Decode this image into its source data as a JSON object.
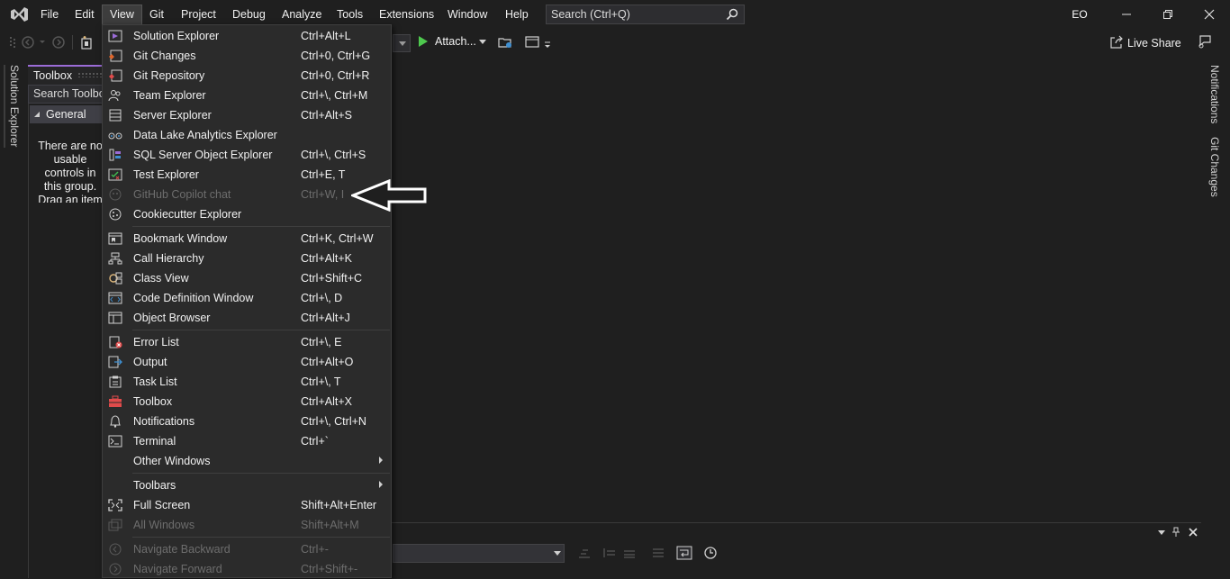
{
  "menubar": {
    "items": [
      "File",
      "Edit",
      "View",
      "Git",
      "Project",
      "Debug",
      "Analyze",
      "Tools",
      "Extensions",
      "Window",
      "Help"
    ],
    "active": "View"
  },
  "search": {
    "placeholder": "Search (Ctrl+Q)"
  },
  "profile": {
    "initials": "EO"
  },
  "toolbar": {
    "attach_label": "Attach...",
    "live_share_label": "Live Share"
  },
  "left_rail": {
    "solution_explorer": "Solution Explorer"
  },
  "right_rail": {
    "notifications": "Notifications",
    "git_changes": "Git Changes"
  },
  "toolbox": {
    "title": "Toolbox",
    "search_placeholder": "Search Toolbox",
    "group": "General",
    "empty_message": "There are no usable controls in this group. Drag an item onto this text to add it to the toolbox."
  },
  "view_menu": {
    "groups": [
      [
        {
          "label": "Solution Explorer",
          "shortcut": "Ctrl+Alt+L",
          "icon": "solution-explorer-icon",
          "enabled": true
        },
        {
          "label": "Git Changes",
          "shortcut": "Ctrl+0, Ctrl+G",
          "icon": "git-changes-icon",
          "enabled": true
        },
        {
          "label": "Git Repository",
          "shortcut": "Ctrl+0, Ctrl+R",
          "icon": "git-repository-icon",
          "enabled": true
        },
        {
          "label": "Team Explorer",
          "shortcut": "Ctrl+\\, Ctrl+M",
          "icon": "team-explorer-icon",
          "enabled": true
        },
        {
          "label": "Server Explorer",
          "shortcut": "Ctrl+Alt+S",
          "icon": "server-explorer-icon",
          "enabled": true
        },
        {
          "label": "Data Lake Analytics Explorer",
          "shortcut": "",
          "icon": "data-lake-icon",
          "enabled": true
        },
        {
          "label": "SQL Server Object Explorer",
          "shortcut": "Ctrl+\\, Ctrl+S",
          "icon": "sql-server-icon",
          "enabled": true
        },
        {
          "label": "Test Explorer",
          "shortcut": "Ctrl+E, T",
          "icon": "test-explorer-icon",
          "enabled": true
        },
        {
          "label": "GitHub Copilot chat",
          "shortcut": "Ctrl+W, I",
          "icon": "copilot-icon",
          "enabled": false
        },
        {
          "label": "Cookiecutter Explorer",
          "shortcut": "",
          "icon": "cookiecutter-icon",
          "enabled": true
        }
      ],
      [
        {
          "label": "Bookmark Window",
          "shortcut": "Ctrl+K, Ctrl+W",
          "icon": "bookmark-icon",
          "enabled": true
        },
        {
          "label": "Call Hierarchy",
          "shortcut": "Ctrl+Alt+K",
          "icon": "call-hierarchy-icon",
          "enabled": true
        },
        {
          "label": "Class View",
          "shortcut": "Ctrl+Shift+C",
          "icon": "class-view-icon",
          "enabled": true
        },
        {
          "label": "Code Definition Window",
          "shortcut": "Ctrl+\\, D",
          "icon": "code-definition-icon",
          "enabled": true
        },
        {
          "label": "Object Browser",
          "shortcut": "Ctrl+Alt+J",
          "icon": "object-browser-icon",
          "enabled": true
        }
      ],
      [
        {
          "label": "Error List",
          "shortcut": "Ctrl+\\, E",
          "icon": "error-list-icon",
          "enabled": true
        },
        {
          "label": "Output",
          "shortcut": "Ctrl+Alt+O",
          "icon": "output-icon",
          "enabled": true
        },
        {
          "label": "Task List",
          "shortcut": "Ctrl+\\, T",
          "icon": "task-list-icon",
          "enabled": true
        },
        {
          "label": "Toolbox",
          "shortcut": "Ctrl+Alt+X",
          "icon": "toolbox-icon",
          "enabled": true
        },
        {
          "label": "Notifications",
          "shortcut": "Ctrl+\\, Ctrl+N",
          "icon": "bell-icon",
          "enabled": true
        },
        {
          "label": "Terminal",
          "shortcut": "Ctrl+`",
          "icon": "terminal-icon",
          "enabled": true
        },
        {
          "label": "Other Windows",
          "shortcut": "",
          "icon": "",
          "enabled": true,
          "submenu": true
        }
      ],
      [
        {
          "label": "Toolbars",
          "shortcut": "",
          "icon": "",
          "enabled": true,
          "submenu": true
        },
        {
          "label": "Full Screen",
          "shortcut": "Shift+Alt+Enter",
          "icon": "full-screen-icon",
          "enabled": true
        },
        {
          "label": "All Windows",
          "shortcut": "Shift+Alt+M",
          "icon": "all-windows-icon",
          "enabled": false
        }
      ],
      [
        {
          "label": "Navigate Backward",
          "shortcut": "Ctrl+-",
          "icon": "navigate-backward-icon",
          "enabled": false
        },
        {
          "label": "Navigate Forward",
          "shortcut": "Ctrl+Shift+-",
          "icon": "navigate-forward-icon",
          "enabled": false
        }
      ]
    ]
  },
  "colors": {
    "background": "#1f1f1f",
    "menu_background": "#2b2b2b",
    "accent": "#9b6cd7",
    "disabled_text": "#6d6d6d",
    "play_green": "#4ec94e"
  }
}
